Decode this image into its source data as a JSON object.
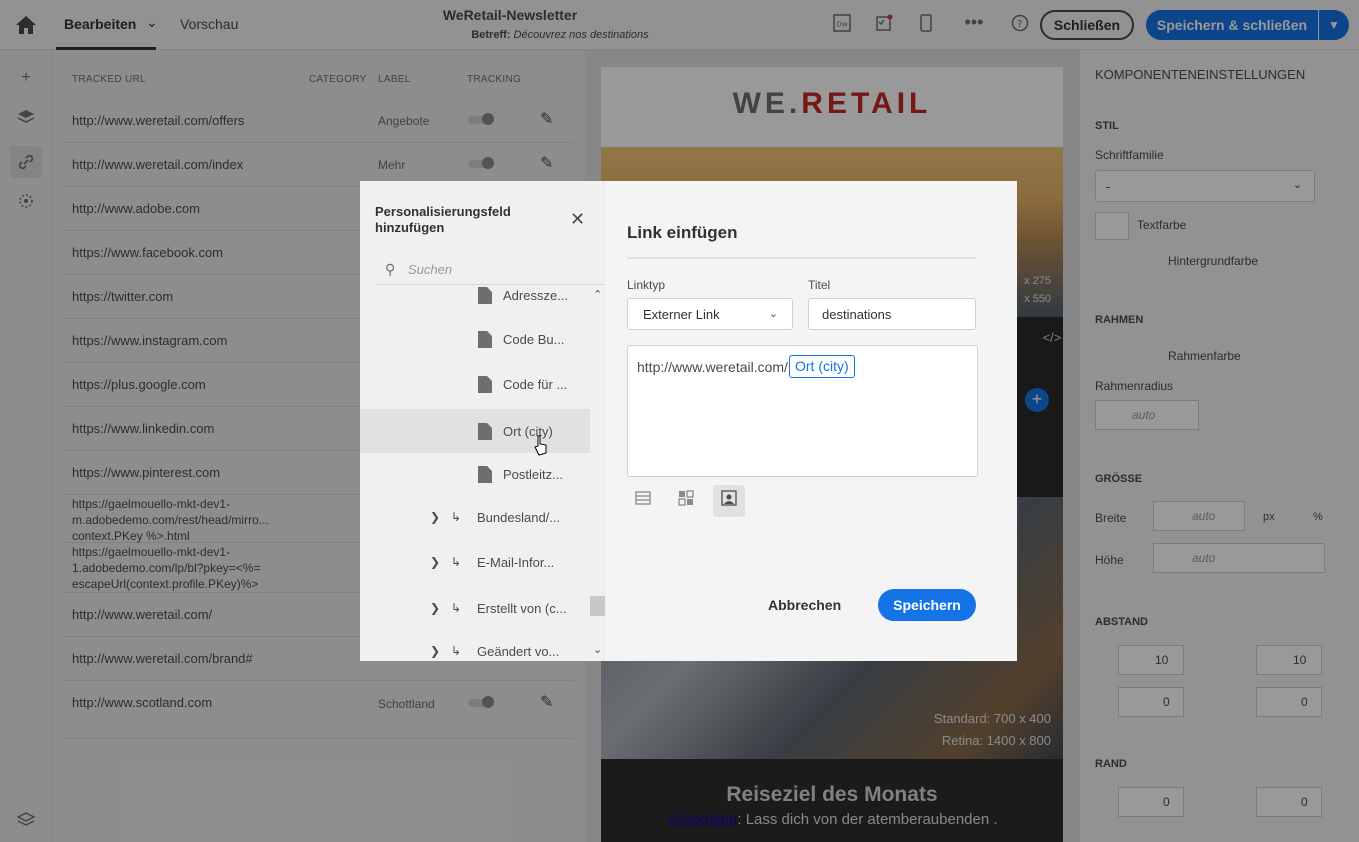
{
  "topbar": {
    "tab_edit": "Bearbeiten",
    "tab_preview": "Vorschau",
    "doc_title": "WeRetail-Newsletter",
    "subject_label": "Betreff:",
    "subject_value": "Découvrez nos destinations",
    "close_label": "Schließen",
    "save_close_label": "Speichern & schließen"
  },
  "urls": {
    "headers": {
      "url": "TRACKED URL",
      "category": "CATEGORY",
      "label": "LABEL",
      "tracking": "TRACKING"
    },
    "rows": [
      {
        "url": "http://www.weretail.com/offers",
        "label": "Angebote"
      },
      {
        "url": "http://www.weretail.com/index",
        "label": "Mehr"
      },
      {
        "url": "http://www.adobe.com",
        "label": ""
      },
      {
        "url": "https://www.facebook.com",
        "label": ""
      },
      {
        "url": "https://twitter.com",
        "label": ""
      },
      {
        "url": "https://www.instagram.com",
        "label": ""
      },
      {
        "url": "https://plus.google.com",
        "label": ""
      },
      {
        "url": "https://www.linkedin.com",
        "label": ""
      },
      {
        "url": "https://www.pinterest.com",
        "label": ""
      },
      {
        "url": "https://gaelmouello-mkt-dev1-",
        "url2": "m.adobedemo.com/rest/head/mirro...",
        "url3": "context.PKey %>.html",
        "label": ""
      },
      {
        "url": "https://gaelmouello-mkt-dev1-",
        "url2": "1.adobedemo.com/lp/bl?pkey=<%=",
        "url3": "escapeUrl(context.profile.PKey)%>",
        "label": ""
      },
      {
        "url": "http://www.weretail.com/",
        "label": ""
      },
      {
        "url": "http://www.weretail.com/brand#",
        "label": ""
      },
      {
        "url": "http://www.scotland.com",
        "label": "Schottland"
      }
    ]
  },
  "email": {
    "logo_left": "WE.",
    "logo_right": "RETAIL",
    "std_top_1": "x 275",
    "std_top_2": "x 550",
    "std_bottom_1": "Standard: 700 x 400",
    "std_bottom_2": "Retina: 1400 x 800",
    "dest_title": "Reiseziel des Monats",
    "dest_link": "Schottland",
    "dest_text": ": Lass dich von der atemberaubenden ."
  },
  "props": {
    "title": "KOMPONENTENEINSTELLUNGEN",
    "style": "STIL",
    "font_family": "Schriftfamilie",
    "font_family_value": "-",
    "text_color": "Textfarbe",
    "bg_color": "Hintergrundfarbe",
    "border": "RAHMEN",
    "border_color": "Rahmenfarbe",
    "border_radius": "Rahmenradius",
    "auto": "auto",
    "size": "GRÖSSE",
    "width": "Breite",
    "height": "Höhe",
    "px": "px",
    "pct": "%",
    "spacing": "ABSTAND",
    "margin": "RAND",
    "v10": "10",
    "v0": "0"
  },
  "perso": {
    "title": "Personalisierungsfeld hinzufügen",
    "search_placeholder": "Suchen",
    "items": [
      {
        "label": "Adressze...",
        "type": "field"
      },
      {
        "label": "Code Bu...",
        "type": "field"
      },
      {
        "label": "Code für ...",
        "type": "field"
      },
      {
        "label": "Ort (city)",
        "type": "field",
        "selected": true
      },
      {
        "label": "Postleitz...",
        "type": "field"
      },
      {
        "label": "Bundesland/...",
        "type": "link"
      },
      {
        "label": "E-Mail-Infor...",
        "type": "link"
      },
      {
        "label": "Erstellt von (c...",
        "type": "link"
      },
      {
        "label": "Geändert vo...",
        "type": "link"
      }
    ]
  },
  "dialog": {
    "title": "Link einfügen",
    "linktype_label": "Linktyp",
    "linktype_value": "Externer Link",
    "title_label": "Titel",
    "title_value": "destinations",
    "url_text": "http://www.weretail.com/",
    "chip": "Ort (city)",
    "cancel": "Abbrechen",
    "save": "Speichern"
  }
}
